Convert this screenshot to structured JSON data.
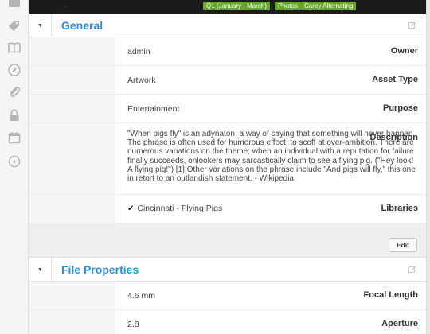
{
  "topbar": {
    "dim_text": "...",
    "tags": [
      "Q1 (January - March)",
      "Photos",
      "Carey Alternating"
    ]
  },
  "rail": {
    "icons": [
      "folder-icon",
      "tag-icon",
      "book-icon",
      "compass-icon",
      "paperclip-icon",
      "lock-icon",
      "calendar-icon",
      "arrow-circle-icon"
    ]
  },
  "general": {
    "title": "General",
    "rows": [
      {
        "label": "Owner",
        "value": "admin"
      },
      {
        "label": "Asset Type",
        "value": "Artwork"
      },
      {
        "label": "Purpose",
        "value": "Entertainment"
      },
      {
        "label": "Description",
        "value": "\"When pigs fly\" is an adynaton, a way of saying that something will never happen. The phrase is often used for humorous effect, to scoff at over-ambition. There are numerous variations on the theme; when an individual with a reputation for failure finally succeeds, onlookers may sarcastically claim to see a flying pig. (\"Hey look! A flying pig!\") [1] Other variations on the phrase include \"And pigs will fly,\" this one in retort to an outlandish statement. - Wikipedia"
      },
      {
        "label": "Libraries",
        "value": "Cincinnati - Flying Pigs"
      }
    ],
    "edit_label": "Edit"
  },
  "file_properties": {
    "title": "File Properties",
    "rows": [
      {
        "label": "Focal Length",
        "value": "4.6 mm"
      },
      {
        "label": "Aperture",
        "value": "2.8"
      }
    ]
  },
  "colors": {
    "accent": "#2f8fcf",
    "tag": "#69a52a",
    "topbar": "#1b1b1b"
  }
}
